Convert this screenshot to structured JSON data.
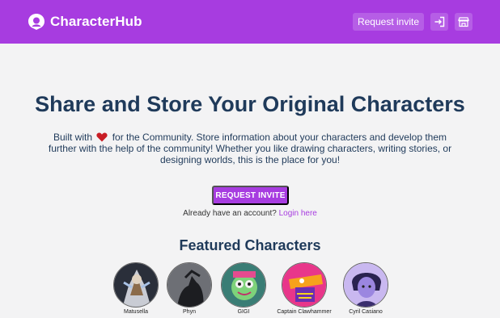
{
  "nav": {
    "brand": "CharacterHub",
    "request_invite": "Request invite",
    "icons": [
      "login-icon",
      "store-icon"
    ]
  },
  "hero": {
    "title": "Share and Store Your Original Characters",
    "text_before": "Built with",
    "text_after": "for the Community. Store information about your characters and develop them further with the help of the community! Whether you like drawing characters, writing stories, or designing worlds, this is the place for you!",
    "cta": "REQUEST INVITE",
    "login_prompt": "Already have an account?",
    "login_link": "Login here"
  },
  "featured": {
    "title": "Featured Characters",
    "characters": [
      {
        "name": "Matusella"
      },
      {
        "name": "Phyn"
      },
      {
        "name": "GIGI"
      },
      {
        "name": "Captain Clawhammer"
      },
      {
        "name": "Cyril Casiano"
      }
    ]
  },
  "colors": {
    "accent": "#a73ce0",
    "heading": "#1f3a5a",
    "background": "#f3f3f4"
  }
}
